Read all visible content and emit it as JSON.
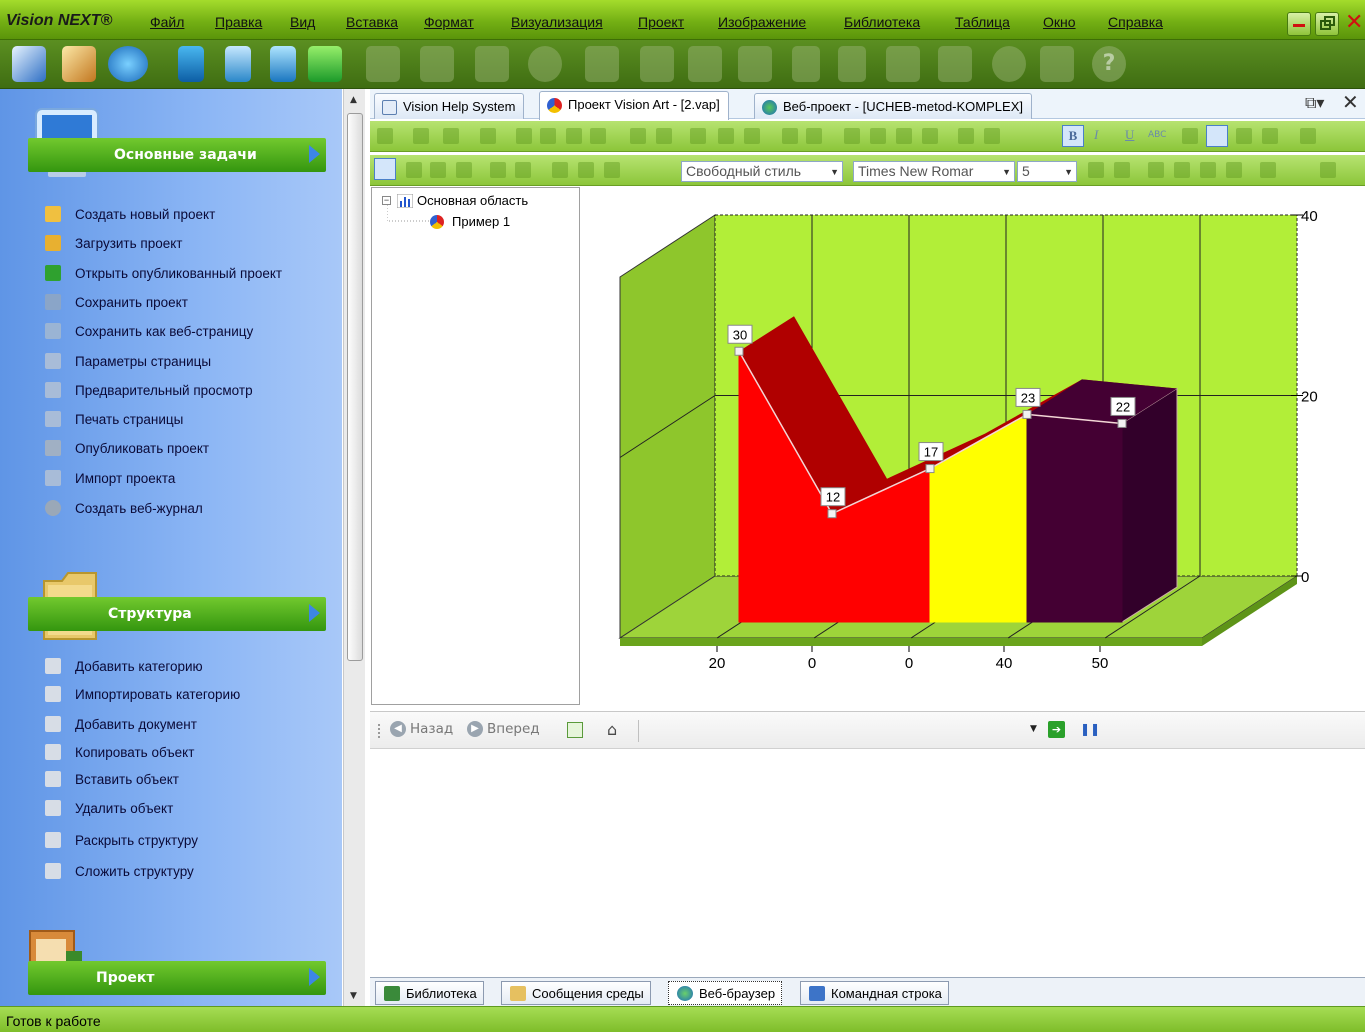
{
  "app": {
    "brand": "Vision NEXT®"
  },
  "menu": [
    "Файл",
    "Правка",
    "Вид",
    "Вставка",
    "Формат",
    "Визуализация",
    "Проект",
    "Изображение",
    "Библиотека",
    "Таблица",
    "Окно",
    "Справка"
  ],
  "sidebar": {
    "main_tasks": {
      "title": "Основные задачи",
      "items": [
        "Создать новый проект",
        "Загрузить проект",
        "Открыть опубликованный проект",
        "Сохранить проект",
        "Сохранить как веб-страницу",
        "Параметры страницы",
        "Предварительный просмотр",
        "Печать страницы",
        "Опубликовать проект",
        "Импорт проекта",
        "Создать веб-журнал"
      ]
    },
    "structure": {
      "title": "Структура",
      "items": [
        "Добавить категорию",
        "Импортировать категорию",
        "Добавить документ",
        "Копировать объект",
        "Вставить объект",
        "Удалить объект",
        "Раскрыть структуру",
        "Сложить структуру"
      ]
    },
    "project": {
      "title": "Проект"
    }
  },
  "doc_tabs": [
    {
      "label": "Vision Help System"
    },
    {
      "label": "Проект Vision Art - [2.vap]"
    },
    {
      "label": "Веб-проект - [UCHEB-metod-KOMPLEX]"
    }
  ],
  "format": {
    "style": "Свободный стиль",
    "font": "Times New Romar",
    "size": "5"
  },
  "tree": {
    "root": "Основная область",
    "child": "Пример 1"
  },
  "chart_data": {
    "type": "area",
    "categories": [
      "20",
      "0",
      "0",
      "40",
      "50"
    ],
    "values": [
      30,
      12,
      17,
      23,
      22
    ],
    "data_labels": [
      "30",
      "12",
      "17",
      "23",
      "22"
    ],
    "ylim": [
      0,
      40
    ],
    "y_ticks": [
      "0",
      "20",
      "40"
    ],
    "colors": {
      "wall": "#b2ee38",
      "area1": "#ff0000",
      "area2": "#ffff00",
      "area3": "#440033",
      "side": "#b00000"
    }
  },
  "browser": {
    "back": "Назад",
    "forward": "Вперед"
  },
  "bottom_tabs": [
    "Библиотека",
    "Сообщения среды",
    "Веб-браузер",
    "Командная строка"
  ],
  "status": "Готов к работе"
}
